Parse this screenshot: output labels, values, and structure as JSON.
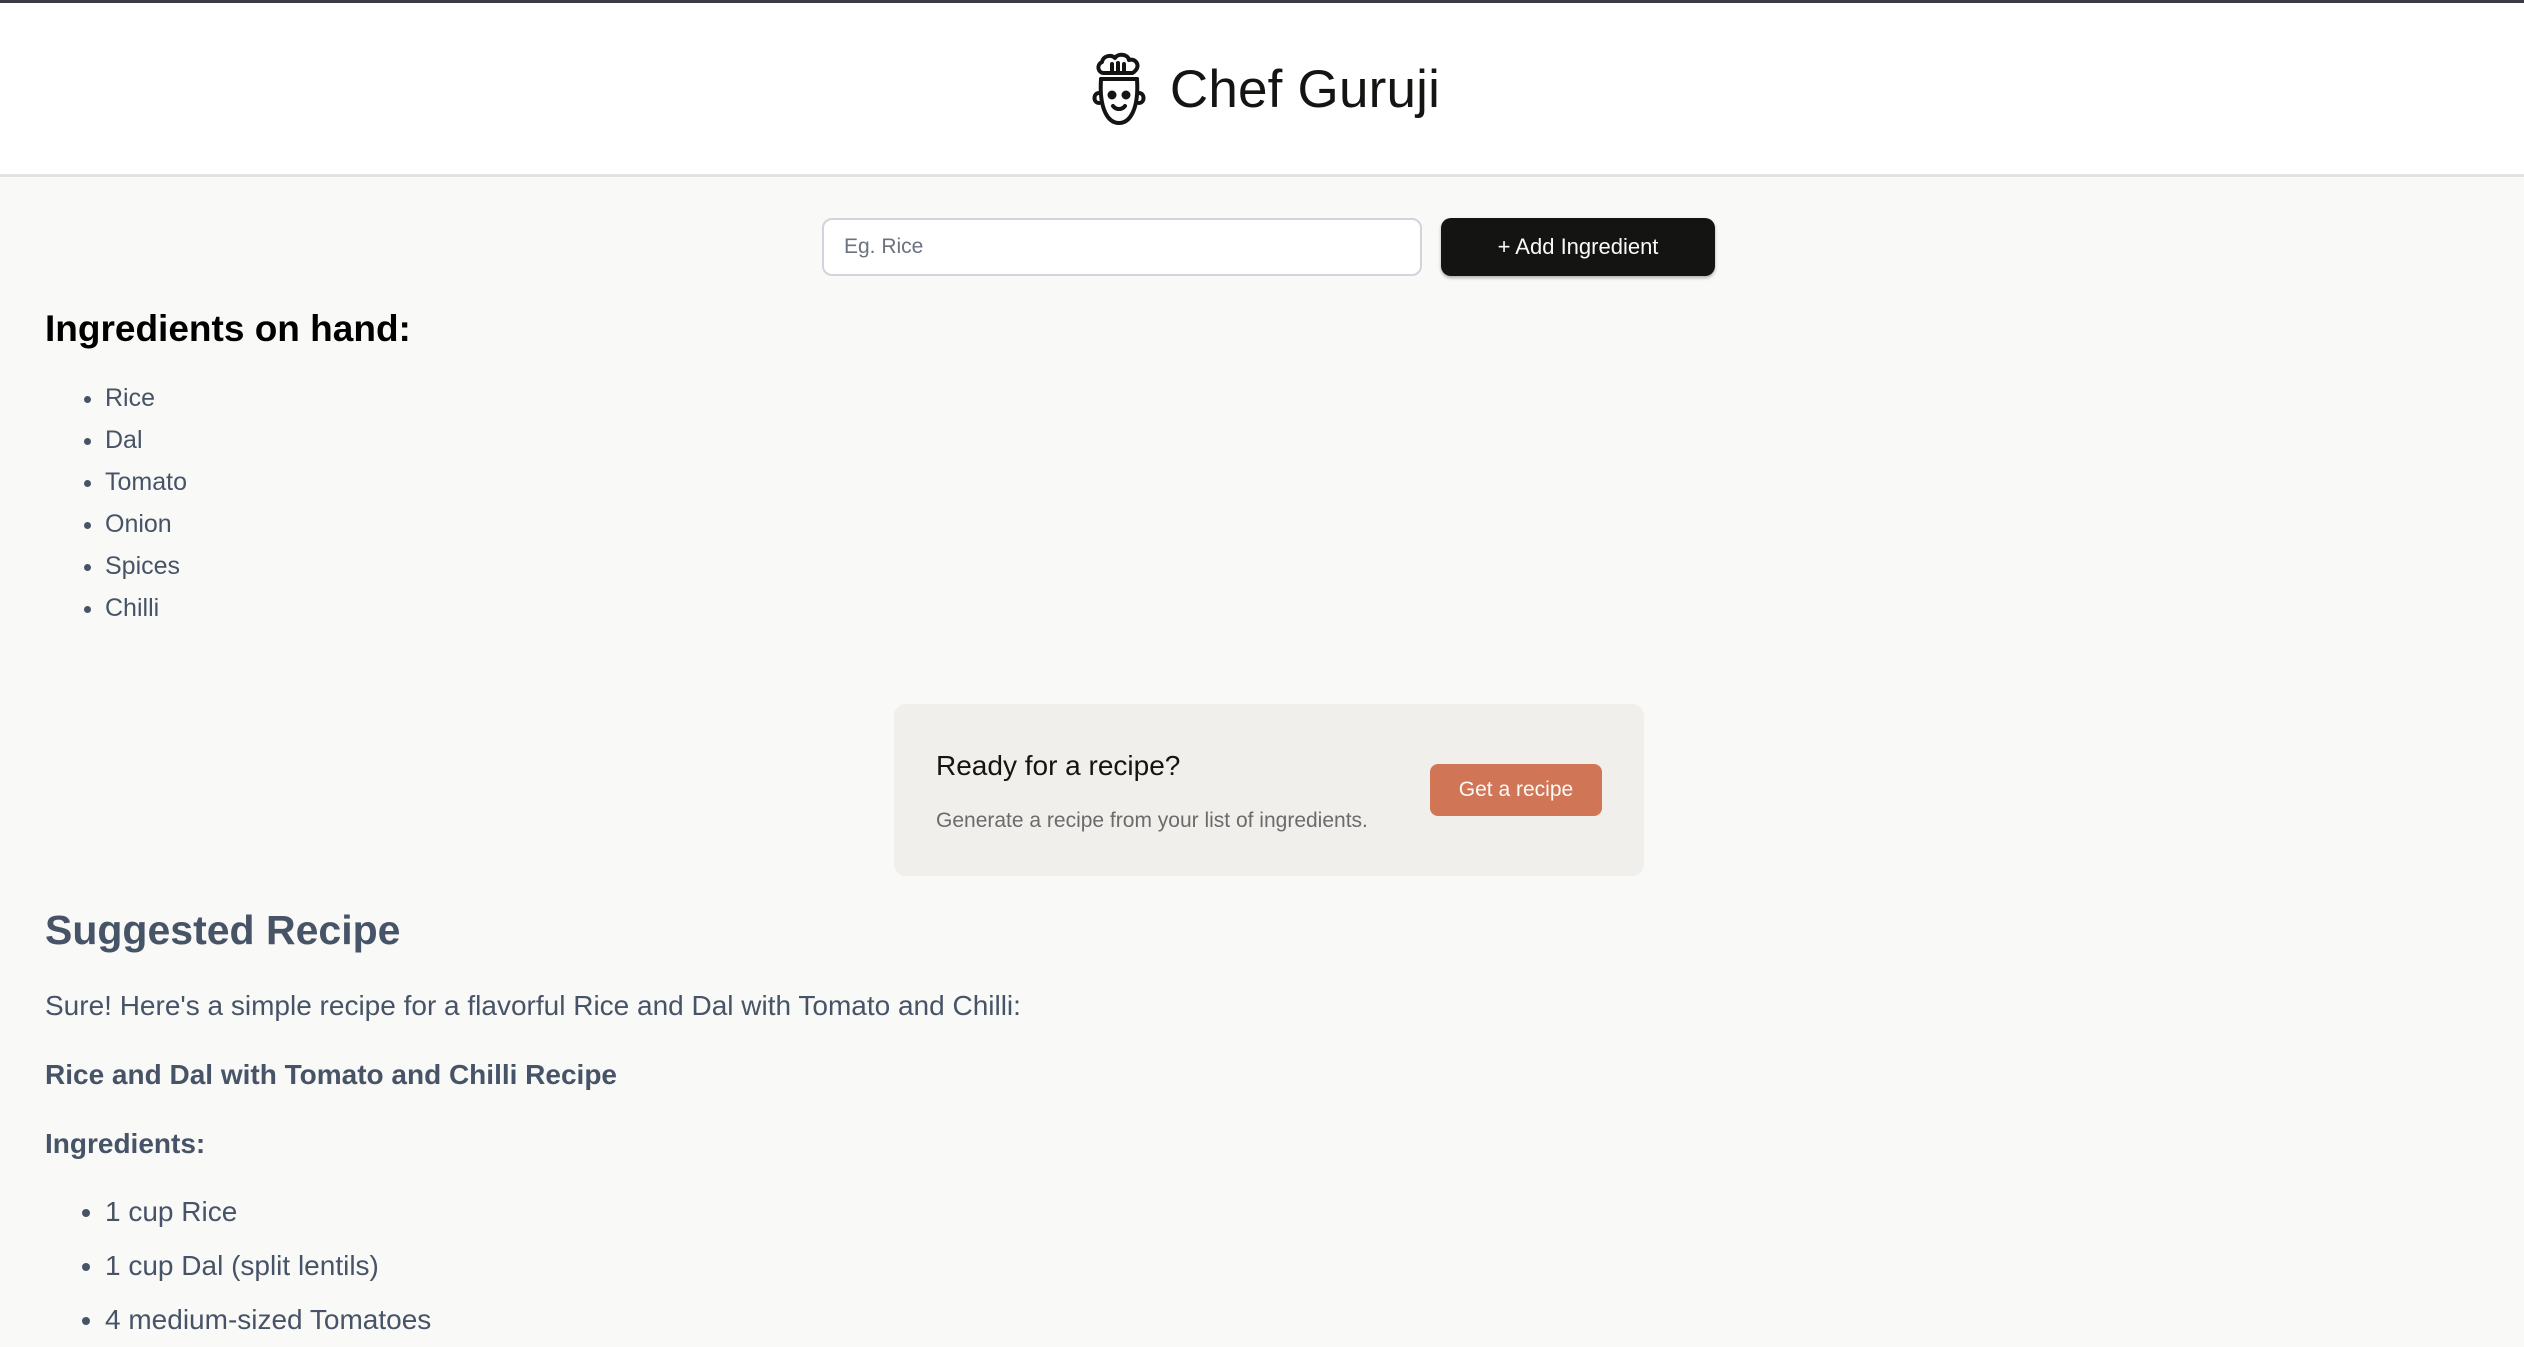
{
  "header": {
    "title": "Chef Guruji",
    "logo_icon": "chef-face-icon"
  },
  "add_form": {
    "input_placeholder": "Eg. Rice",
    "input_value": "",
    "add_button_label": "+ Add Ingredient"
  },
  "ingredients": {
    "heading": "Ingredients on hand:",
    "items": [
      "Rice",
      "Dal",
      "Tomato",
      "Onion",
      "Spices",
      "Chilli"
    ]
  },
  "cta": {
    "title": "Ready for a recipe?",
    "subtitle": "Generate a recipe from your list of ingredients.",
    "button_label": "Get a recipe"
  },
  "recipe": {
    "heading": "Suggested Recipe",
    "intro": "Sure! Here's a simple recipe for a flavorful Rice and Dal with Tomato and Chilli:",
    "name": "Rice and Dal with Tomato and Chilli Recipe",
    "ingredients_heading": "Ingredients:",
    "ingredients": [
      "1 cup Rice",
      "1 cup Dal (split lentils)",
      "4 medium-sized Tomatoes"
    ]
  },
  "colors": {
    "accent": "#d17557",
    "dark_button": "#141413",
    "background": "#f9f9f7",
    "card": "#f0efeb",
    "text_muted": "#475467"
  }
}
